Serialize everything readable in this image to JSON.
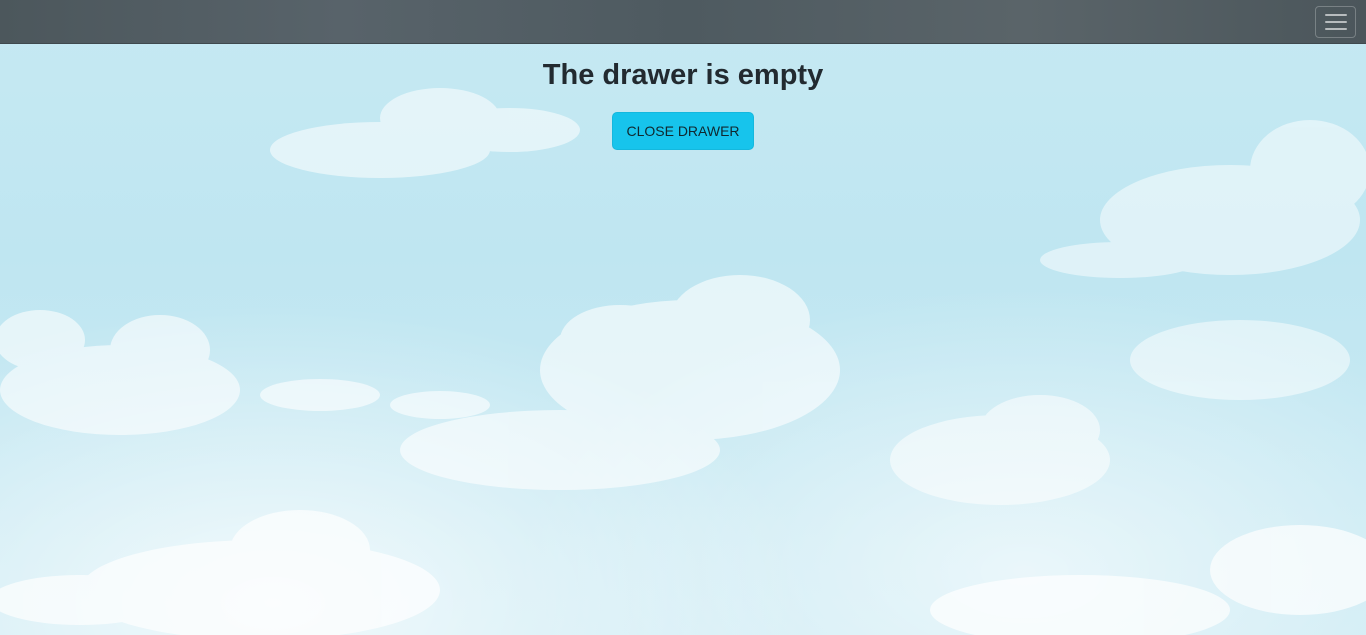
{
  "navbar": {
    "toggler_icon": "hamburger-menu-icon"
  },
  "main": {
    "title": "The drawer is empty",
    "close_button_label": "CLOSE DRAWER"
  },
  "colors": {
    "navbar": "#525d62",
    "button": "#17c4ec",
    "heading": "#222a30",
    "sky": "#c3e7f2"
  }
}
